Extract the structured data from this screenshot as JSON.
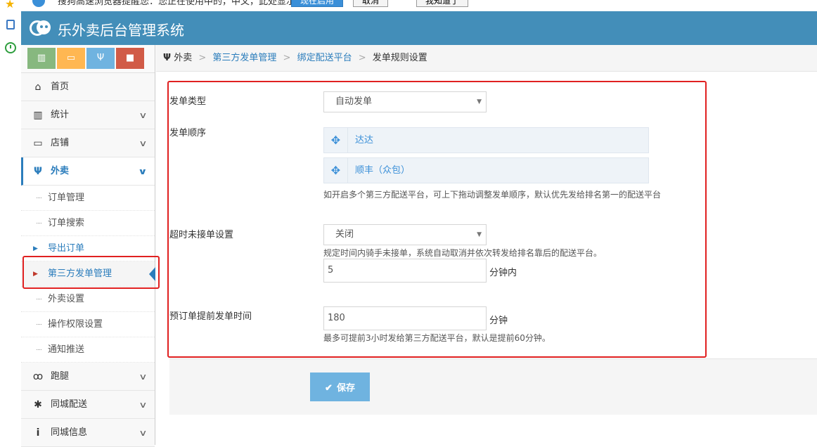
{
  "app": {
    "title": "乐外卖后台管理系统"
  },
  "colors": {
    "header": "#438eb9",
    "accent": "#2b7dbc",
    "highlight_box": "#e02020",
    "save_button": "#6fb3e0"
  },
  "browser_sidebar": {
    "icons": [
      "star-icon",
      "tablet-icon",
      "clock-icon"
    ]
  },
  "notice_bar": {
    "icon": "info-icon",
    "text": "搜狗高速浏览器提醒您：您正在使用中的，中文，此处显示最新信息。",
    "buttons": [
      "现在启用",
      "取消",
      "我知道了"
    ]
  },
  "shortcuts": [
    {
      "icon": "bar-chart-icon",
      "glyph": "▥",
      "color": "#87b87f"
    },
    {
      "icon": "desktop-icon",
      "glyph": "▭",
      "color": "#ffb752"
    },
    {
      "icon": "fork-icon",
      "glyph": "Ψ",
      "color": "#6fb3e0"
    },
    {
      "icon": "briefcase-icon",
      "glyph": "■",
      "color": "#d15b47"
    }
  ],
  "nav": {
    "home": "首页",
    "stats": "统计",
    "shop": "店铺",
    "takeout": "外卖",
    "takeout_sub": [
      "订单管理",
      "订单搜索",
      "导出订单",
      "第三方发单管理",
      "外卖设置",
      "操作权限设置",
      "通知推送"
    ],
    "errand": "跑腿",
    "city_delivery": "同城配送",
    "city_info": "同城信息"
  },
  "breadcrumb": {
    "icon": "fork-icon",
    "items": [
      "外卖",
      "第三方发单管理",
      "绑定配送平台",
      "发单规则设置"
    ]
  },
  "form": {
    "dispatch_type": {
      "label": "发单类型",
      "value": "自动发单"
    },
    "dispatch_order": {
      "label": "发单顺序",
      "platforms": [
        "达达",
        "顺丰（众包）"
      ],
      "help": "如开启多个第三方配送平台，可上下拖动调整发单顺序，默认优先发给排名第一的配送平台"
    },
    "timeout": {
      "label": "超时未接单设置",
      "value": "关闭",
      "help": "规定时间内骑手未接单，系统自动取消并依次转发给排名靠后的配送平台。",
      "minutes": "5",
      "unit": "分钟内"
    },
    "preorder": {
      "label": "预订单提前发单时间",
      "value": "180",
      "unit": "分钟",
      "help": "最多可提前3小时发给第三方配送平台，默认是提前60分钟。"
    },
    "save_label": "保存"
  }
}
